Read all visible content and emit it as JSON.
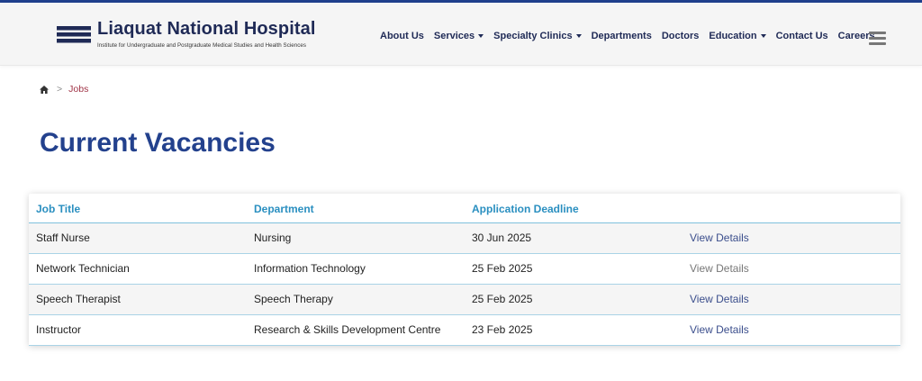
{
  "brand": {
    "name": "Liaquat National Hospital",
    "tagline": "Institute for Undergraduate and Postgraduate Medical Studies and Health Sciences",
    "colors": {
      "navy": "#1f2a56",
      "red": "#c8102e",
      "accent": "#2a8fc0",
      "title": "#23418d"
    }
  },
  "nav": {
    "items": [
      {
        "label": "About Us",
        "dropdown": false
      },
      {
        "label": "Services",
        "dropdown": true
      },
      {
        "label": "Specialty Clinics",
        "dropdown": true
      },
      {
        "label": "Departments",
        "dropdown": false
      },
      {
        "label": "Doctors",
        "dropdown": false
      },
      {
        "label": "Education",
        "dropdown": true
      },
      {
        "label": "Contact Us",
        "dropdown": false
      },
      {
        "label": "Careers",
        "dropdown": false
      }
    ],
    "menu_icon": "hamburger-icon"
  },
  "breadcrumb": {
    "home_icon": "home-icon",
    "separator": ">",
    "current": "Jobs"
  },
  "page": {
    "title": "Current Vacancies"
  },
  "table": {
    "headers": [
      "Job Title",
      "Department",
      "Application Deadline",
      ""
    ],
    "rows": [
      {
        "title": "Staff Nurse",
        "department": "Nursing",
        "deadline": "30 Jun 2025",
        "action": "View Details",
        "muted": false
      },
      {
        "title": "Network Technician",
        "department": "Information Technology",
        "deadline": "25 Feb 2025",
        "action": "View Details",
        "muted": true
      },
      {
        "title": "Speech Therapist",
        "department": "Speech Therapy",
        "deadline": "25 Feb 2025",
        "action": "View Details",
        "muted": false
      },
      {
        "title": "Instructor",
        "department": "Research & Skills Development Centre",
        "deadline": "23 Feb 2025",
        "action": "View Details",
        "muted": false
      }
    ]
  }
}
